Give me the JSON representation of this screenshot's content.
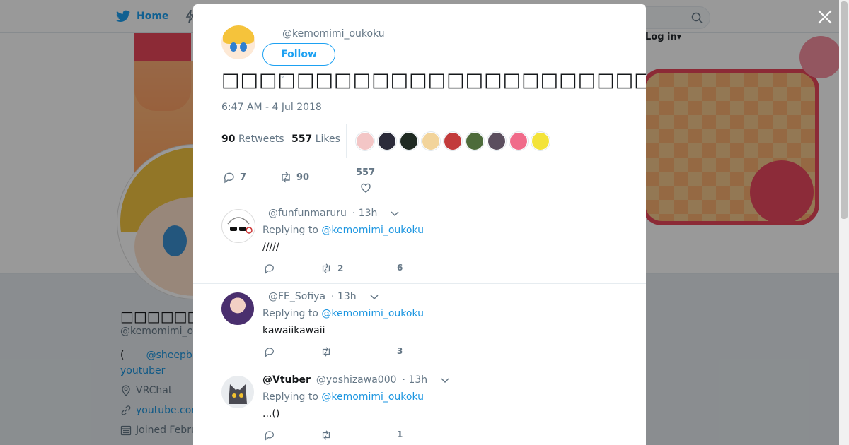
{
  "nav": {
    "home_label": "Home",
    "login_label": "Log in"
  },
  "profile": {
    "display_name": "□□□□□□□□□□",
    "handle": "@kemomimi_o",
    "bio_open": "(",
    "bio_mention": "@sheepb",
    "bio_line2": "youtuber",
    "location": "VRChat",
    "website": "youtube.cor",
    "joined": "Joined Febru"
  },
  "tweet": {
    "handle": "@kemomimi_oukoku",
    "follow_label": "Follow",
    "text": "□□□□□□□□□□□□□□□□□□□□□□□□□□□□□□□□□□□□□□□□□□□□",
    "time": "6:47 AM - 4 Jul 2018",
    "retweets_count": "90",
    "retweets_label": "Retweets",
    "likes_count": "557",
    "likes_label": "Likes",
    "liker_colors": [
      "#f3c6c6",
      "#2b2b3a",
      "#1f2a22",
      "#f2d49b",
      "#c23b3b",
      "#4d6b3a",
      "#5b4e5e",
      "#f06b8a",
      "#f3e33a"
    ],
    "actions": {
      "replies": "7",
      "retweets": "90",
      "likes": "557"
    }
  },
  "replies": [
    {
      "display_name": "",
      "handle": "@funfunmaruru",
      "time": "· 13h",
      "replying_prefix": "Replying to",
      "replying_to": "@kemomimi_oukoku",
      "text": "/////",
      "reply_count": "",
      "retweet_count": "2",
      "like_count": "6"
    },
    {
      "display_name": "",
      "handle": "@FE_Sofiya",
      "time": "· 13h",
      "replying_prefix": "Replying to",
      "replying_to": "@kemomimi_oukoku",
      "text": "kawaiikawaii",
      "reply_count": "",
      "retweet_count": "",
      "like_count": "3"
    },
    {
      "display_name": "@Vtuber",
      "handle": "@yoshizawa000",
      "time": "· 13h",
      "replying_prefix": "Replying to",
      "replying_to": "@kemomimi_oukoku",
      "text": "...()",
      "reply_count": "",
      "retweet_count": "",
      "like_count": "1"
    }
  ],
  "colors": {
    "accent": "#1da1f2",
    "link": "#1b95e0",
    "muted": "#657786"
  }
}
